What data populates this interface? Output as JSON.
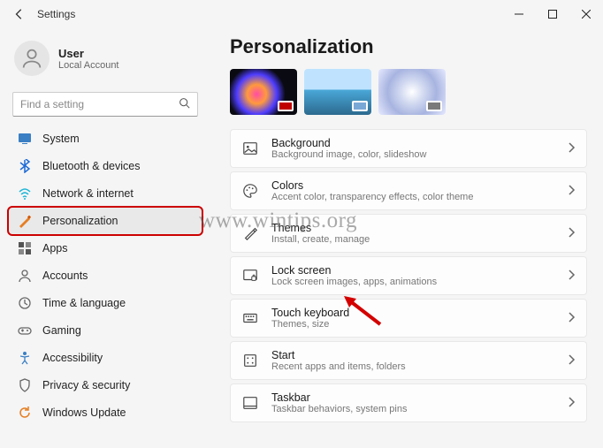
{
  "window": {
    "title": "Settings"
  },
  "user": {
    "name": "User",
    "subtitle": "Local Account"
  },
  "search": {
    "placeholder": "Find a setting"
  },
  "nav": {
    "items": [
      {
        "label": "System"
      },
      {
        "label": "Bluetooth & devices"
      },
      {
        "label": "Network & internet"
      },
      {
        "label": "Personalization"
      },
      {
        "label": "Apps"
      },
      {
        "label": "Accounts"
      },
      {
        "label": "Time & language"
      },
      {
        "label": "Gaming"
      },
      {
        "label": "Accessibility"
      },
      {
        "label": "Privacy & security"
      },
      {
        "label": "Windows Update"
      }
    ]
  },
  "page": {
    "title": "Personalization",
    "theme_colors": {
      "t1_corner": "#c00000",
      "t2_corner": "#7aa8d6",
      "t3_corner": "#7a7a7a"
    },
    "cards": [
      {
        "title": "Background",
        "subtitle": "Background image, color, slideshow"
      },
      {
        "title": "Colors",
        "subtitle": "Accent color, transparency effects, color theme"
      },
      {
        "title": "Themes",
        "subtitle": "Install, create, manage"
      },
      {
        "title": "Lock screen",
        "subtitle": "Lock screen images, apps, animations"
      },
      {
        "title": "Touch keyboard",
        "subtitle": "Themes, size"
      },
      {
        "title": "Start",
        "subtitle": "Recent apps and items, folders"
      },
      {
        "title": "Taskbar",
        "subtitle": "Taskbar behaviors, system pins"
      }
    ]
  },
  "watermark": "www.wintips.org"
}
